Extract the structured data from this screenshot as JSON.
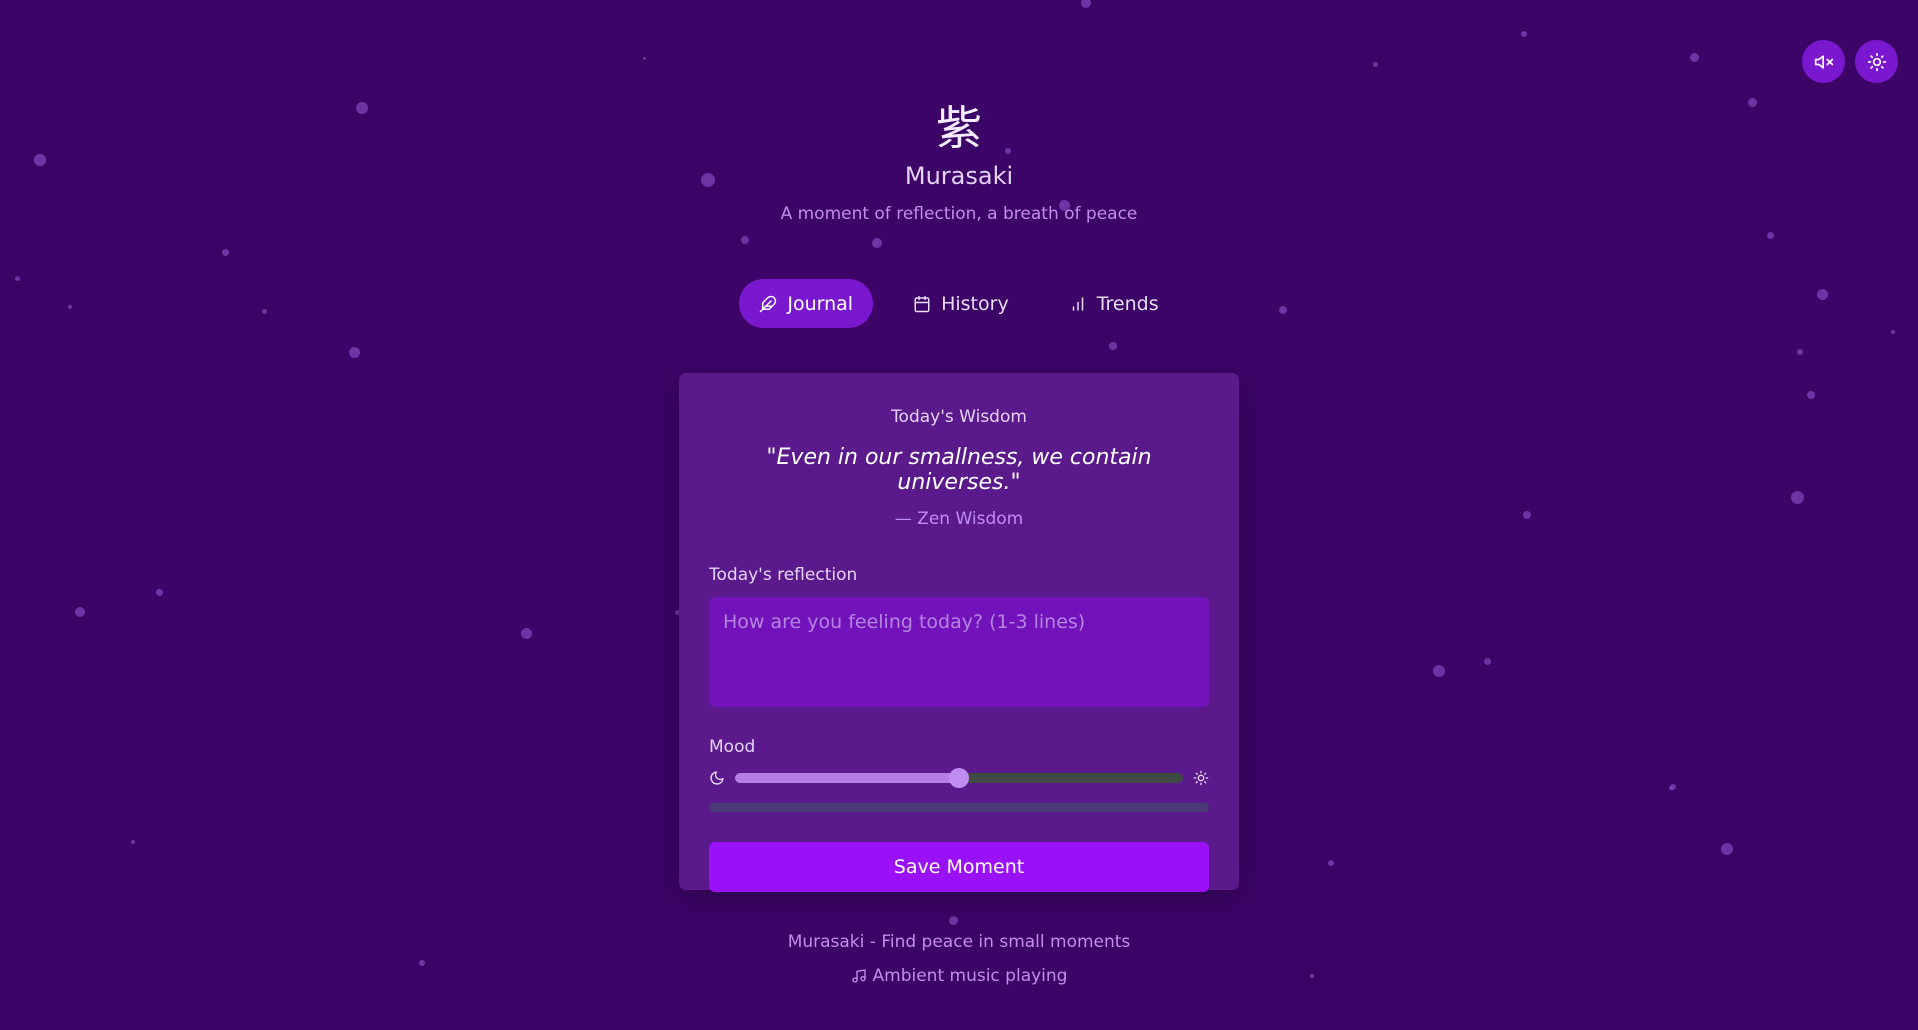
{
  "header": {
    "logo_char": "紫",
    "title": "Murasaki",
    "tagline": "A moment of reflection, a breath of peace"
  },
  "top_controls": {
    "mute_icon": "speaker-muted-icon",
    "theme_icon": "sun-icon"
  },
  "tabs": [
    {
      "label": "Journal",
      "icon": "feather-icon",
      "active": true
    },
    {
      "label": "History",
      "icon": "calendar-icon",
      "active": false
    },
    {
      "label": "Trends",
      "icon": "bar-chart-icon",
      "active": false
    }
  ],
  "card": {
    "wisdom_label": "Today's Wisdom",
    "quote": "\"Even in our smallness, we contain universes.\"",
    "quote_author": "— Zen Wisdom",
    "reflection_label": "Today's reflection",
    "reflection_placeholder": "How are you feeling today? (1-3 lines)",
    "reflection_value": "",
    "mood_label": "Mood",
    "mood_value": 0.5,
    "mood_min_icon": "moon-icon",
    "mood_max_icon": "sun-icon",
    "save_label": "Save Moment"
  },
  "footer": {
    "line1": "Murasaki - Find peace in small moments",
    "line2": "Ambient music playing",
    "music_icon": "music-note-icon"
  },
  "colors": {
    "background": "#3c0466",
    "card": "#5b1a8c",
    "accent": "#9b11f7",
    "active_tab": "#7a18d0"
  }
}
